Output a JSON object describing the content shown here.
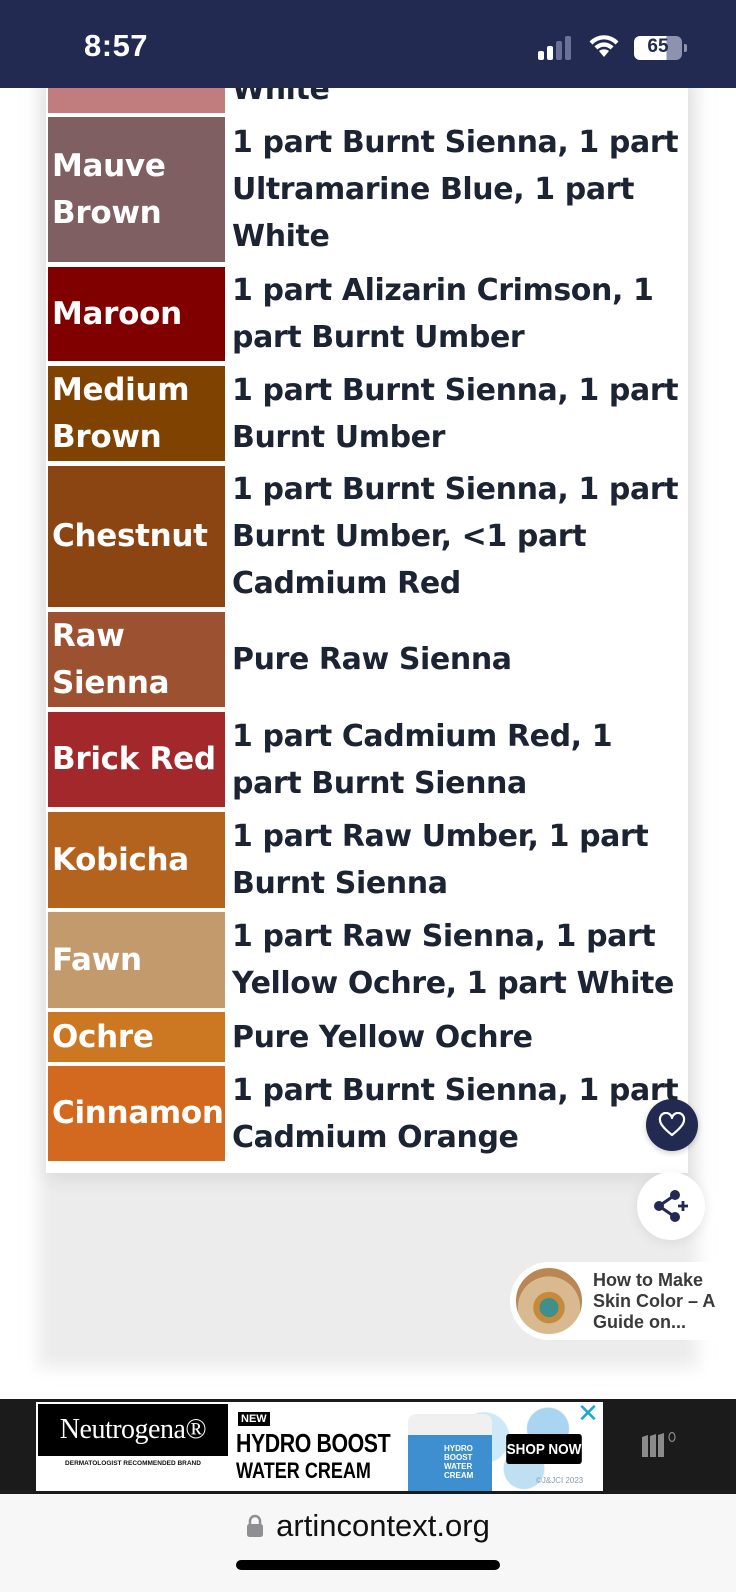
{
  "status_bar": {
    "time": "8:57",
    "battery": "65",
    "signal_bars_active": 2,
    "signal_bars_total": 4
  },
  "colors": {
    "status_bar_bg": "#232a52",
    "text_dark": "#1c2333",
    "accent_navy": "#232a52"
  },
  "table": {
    "rows": [
      {
        "name": "",
        "recipe": "White",
        "color": "#c17c7e"
      },
      {
        "name": "Mauve Brown",
        "recipe": "1 part Burnt Sienna, 1 part Ultramarine Blue, 1 part White",
        "color": "#7f5f61"
      },
      {
        "name": "Maroon",
        "recipe": "1 part Alizarin Crimson, 1 part Burnt Umber",
        "color": "#800000"
      },
      {
        "name": "Medium Brown",
        "recipe": "1 part Burnt Sienna, 1 part Burnt Umber",
        "color": "#7f4200"
      },
      {
        "name": "Chestnut",
        "recipe": "1 part Burnt Sienna, 1 part Burnt Umber, <1 part Cadmium Red",
        "color": "#8a4513"
      },
      {
        "name": "Raw Sienna",
        "recipe": "Pure Raw Sienna",
        "color": "#9c5130"
      },
      {
        "name": "Brick Red",
        "recipe": "1 part Cadmium Red, 1 part Burnt Sienna",
        "color": "#a3282b"
      },
      {
        "name": "Kobicha",
        "recipe": "1 part Raw Umber, 1 part Burnt Sienna",
        "color": "#b3631d"
      },
      {
        "name": "Fawn",
        "recipe": "1 part Raw Sienna, 1 part Yellow Ochre, 1 part White",
        "color": "#c39a6b"
      },
      {
        "name": "Ochre",
        "recipe": "Pure Yellow Ochre",
        "color": "#cc7722"
      },
      {
        "name": "Cinnamon",
        "recipe": "1 part Burnt Sienna, 1 part Cadmium Orange",
        "color": "#d2691e"
      }
    ]
  },
  "floating": {
    "heart_icon": "heart-icon",
    "share_icon": "share-plus-icon"
  },
  "related": {
    "title": "How to Make Skin Color – A Guide on..."
  },
  "ad": {
    "brand": "Neutrogena®",
    "tagline": "DERMATOLOGIST RECOMMENDED BRAND",
    "badge": "NEW",
    "headline1": "HYDRO BOOST",
    "headline2": "WATER CREAM",
    "jar_label": "HYDRO BOOST WATER CREAM",
    "cta": "SHOP NOW",
    "close": "✕",
    "copyright": "©J&JCI 2023"
  },
  "url_bar": {
    "domain": "artincontext.org"
  }
}
